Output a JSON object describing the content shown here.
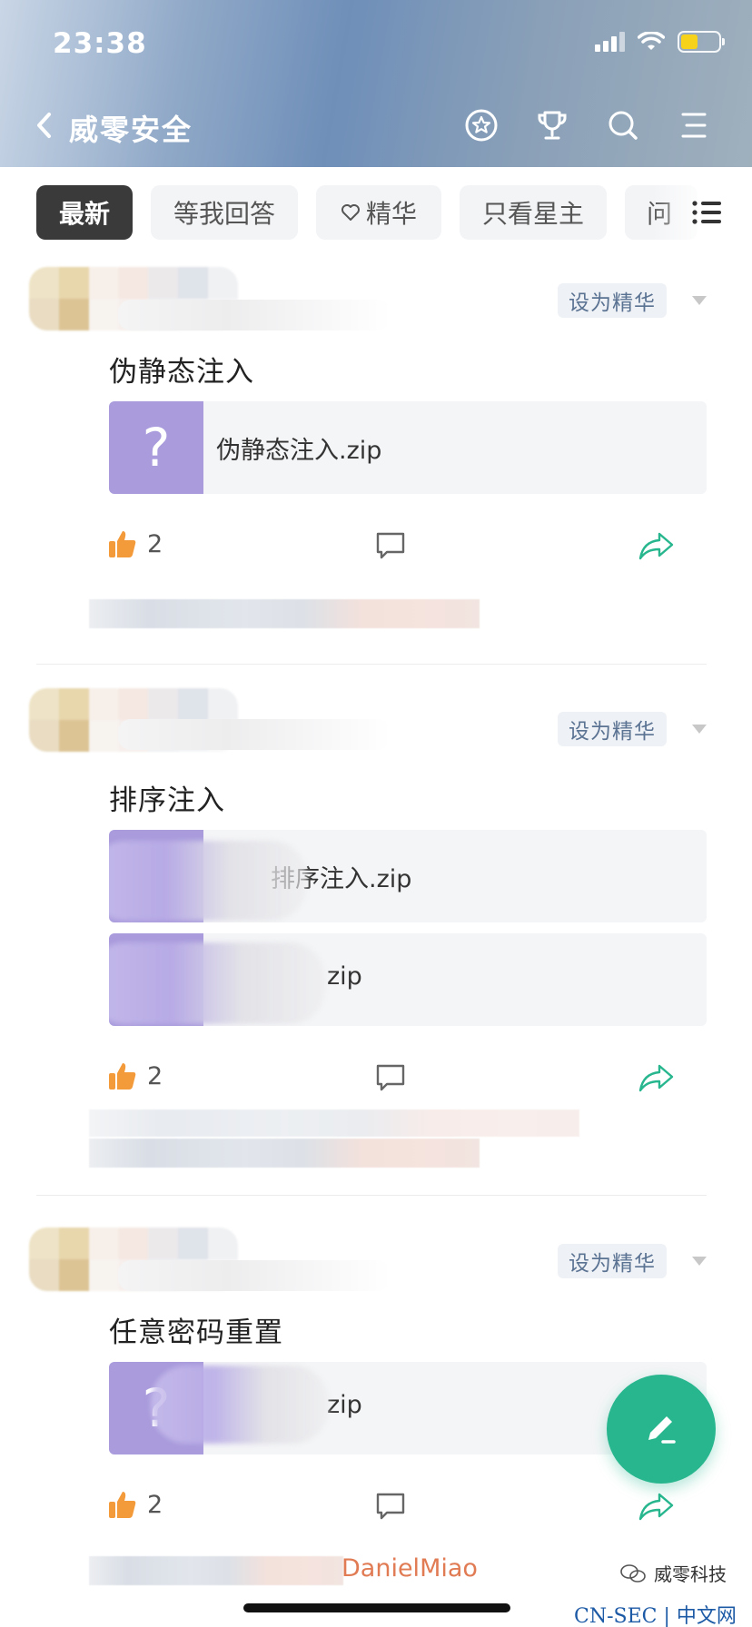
{
  "status_bar": {
    "time": "23:38"
  },
  "nav": {
    "title": "威零安全",
    "back_icon": "chevron-left-icon",
    "icons": [
      "star-badge-icon",
      "trophy-icon",
      "search-icon",
      "menu-icon"
    ]
  },
  "tabs": [
    {
      "label": "最新",
      "active": true
    },
    {
      "label": "等我回答"
    },
    {
      "label": "精华",
      "icon": "heart-icon"
    },
    {
      "label": "只看星主"
    },
    {
      "label": "问"
    }
  ],
  "posts": [
    {
      "essence_label": "设为精华",
      "title": "伪静态注入",
      "attachments": [
        {
          "thumb_symbol": "?",
          "name": "伪静态注入.zip"
        }
      ],
      "likes": "2"
    },
    {
      "essence_label": "设为精华",
      "title": "排序注入",
      "attachments": [
        {
          "name": "排序注入.zip"
        },
        {
          "name": "zip"
        }
      ],
      "likes": "2"
    },
    {
      "essence_label": "设为精华",
      "title": "任意密码重置",
      "attachments": [
        {
          "thumb_symbol": "?",
          "name": "zip"
        }
      ],
      "likes": "2"
    }
  ],
  "footer": {
    "credit_name": "DanielMiao",
    "wechat_mark": "威零科技",
    "site_mark": "CN-SEC | 中文网"
  },
  "colors": {
    "accent_green": "#27b68e",
    "essence_text": "#5b7393",
    "file_thumb": "#a99bdc",
    "like_orange": "#f39a3a"
  }
}
